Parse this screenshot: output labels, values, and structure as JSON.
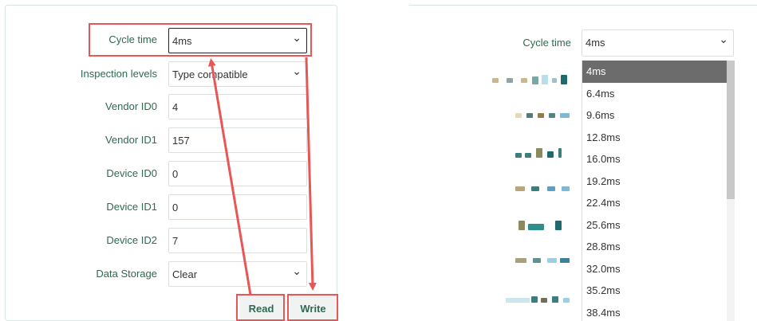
{
  "left_form": {
    "rows": [
      {
        "label": "Cycle time",
        "value": "4ms",
        "type": "select"
      },
      {
        "label": "Inspection levels",
        "value": "Type compatible",
        "type": "select"
      },
      {
        "label": "Vendor ID0",
        "value": "4",
        "type": "text"
      },
      {
        "label": "Vendor ID1",
        "value": "157",
        "type": "text"
      },
      {
        "label": "Device ID0",
        "value": "0",
        "type": "text"
      },
      {
        "label": "Device ID1",
        "value": "0",
        "type": "text"
      },
      {
        "label": "Device ID2",
        "value": "7",
        "type": "text"
      },
      {
        "label": "Data Storage",
        "value": "Clear",
        "type": "select"
      }
    ],
    "buttons": {
      "read": "Read",
      "write": "Write"
    }
  },
  "right_panel": {
    "cycle_label": "Cycle time",
    "cycle_value": "4ms",
    "options": [
      "4ms",
      "6.4ms",
      "9.6ms",
      "12.8ms",
      "16.0ms",
      "19.2ms",
      "22.4ms",
      "25.6ms",
      "28.8ms",
      "32.0ms",
      "35.2ms",
      "38.4ms"
    ],
    "selected_index": 0
  },
  "colors": {
    "label_green": "#2d6a4f",
    "annotation_red": "#e85656",
    "selected_bg": "#6c6c6c"
  }
}
